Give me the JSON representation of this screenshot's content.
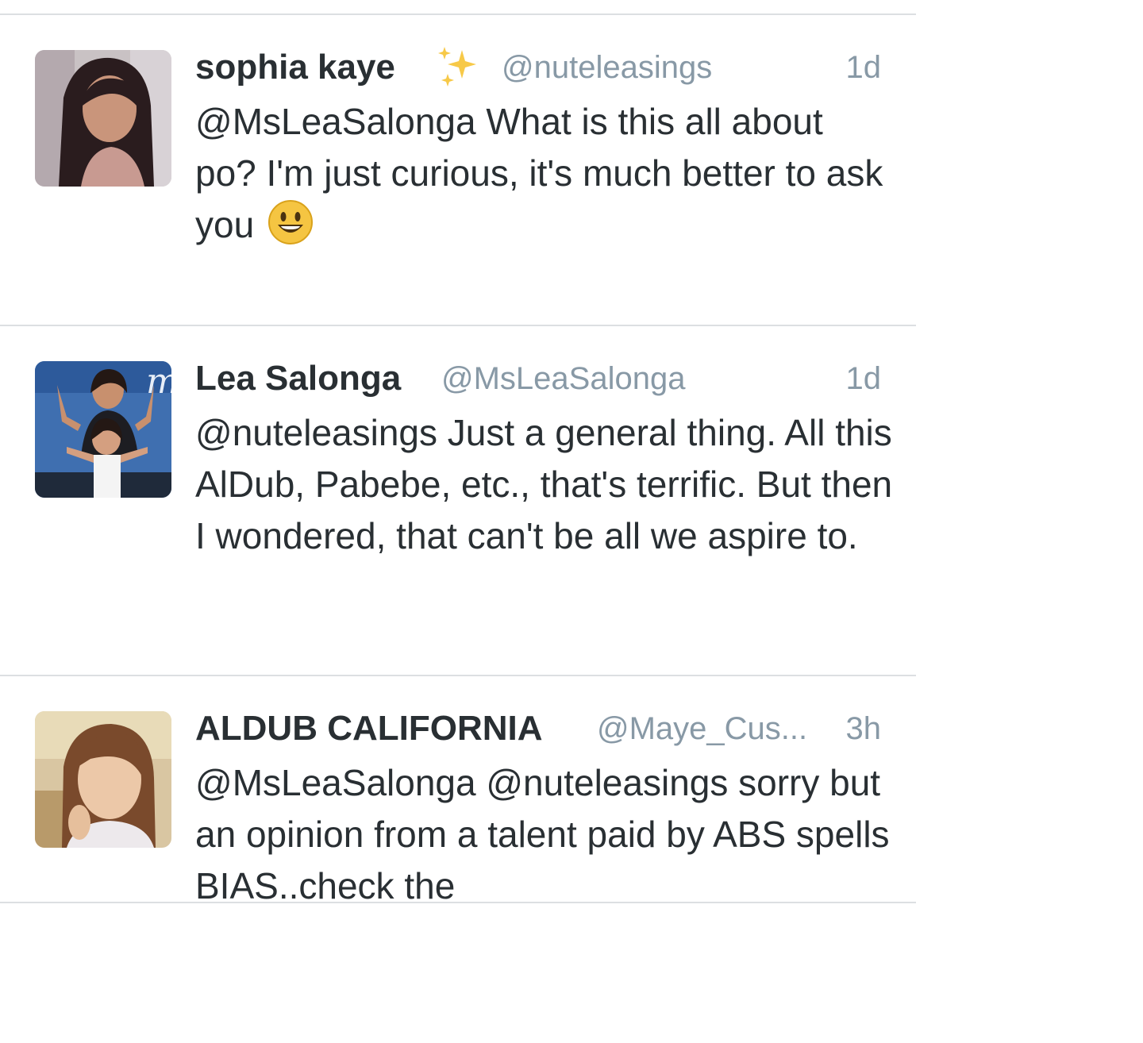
{
  "tweets": [
    {
      "name": "sophia kaye",
      "handle": "@nuteleasings",
      "time": "1d",
      "text": "@MsLeaSalonga What is this all about po? I'm just curious, it's much better to ask you",
      "emoji": "smiling-face-emoji",
      "name_emoji": "sparkles-icon"
    },
    {
      "name": "Lea Salonga",
      "handle": "@MsLeaSalonga",
      "time": "1d",
      "text": "@nuteleasings Just a general thing. All this AlDub, Pabebe, etc., that's terrific. But then I wondered, that can't be all we aspire to."
    },
    {
      "name": "ALDUB CALIFORNIA",
      "handle": "@Maye_Cus...",
      "time": "3h",
      "text": "@MsLeaSalonga @nuteleasings sorry but an opinion from a talent paid by ABS spells BIAS..check the"
    }
  ],
  "colors": {
    "text": "#292f33",
    "muted": "#8899a6",
    "divider": "#dcdfe2"
  }
}
